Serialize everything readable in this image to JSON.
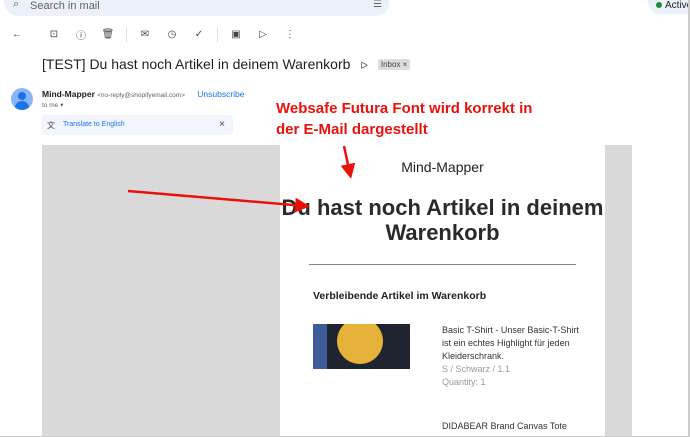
{
  "search": {
    "placeholder": "Search in mail"
  },
  "status": {
    "label": "Active"
  },
  "email": {
    "subject": "[TEST] Du hast noch Artikel in deinem Warenkorb",
    "label": "Inbox",
    "sender_name": "Mind-Mapper",
    "sender_email": "<no-reply@shopifyemail.com>",
    "unsubscribe": "Unsubscribe",
    "recipient": "to me",
    "translate": "Translate to English"
  },
  "body": {
    "shop_name": "Mind-Mapper",
    "headline": "Du hast noch Artikel in deinem Warenkorb",
    "section_title": "Verbleibende Artikel im Warenkorb",
    "items": [
      {
        "title": "Basic T-Shirt - Unser Basic-T-Shirt ist ein echtes Highlight für jeden Kleiderschrank.",
        "variant": "S / Schwarz / 1.1",
        "quantity": "Quantity: 1"
      },
      {
        "title": "DIDABEAR Brand Canvas Tote"
      }
    ]
  },
  "annotation": {
    "line1": "Websafe Futura Font wird korrekt in",
    "line2": "der E-Mail dargestellt",
    "color": "#e8120c"
  }
}
